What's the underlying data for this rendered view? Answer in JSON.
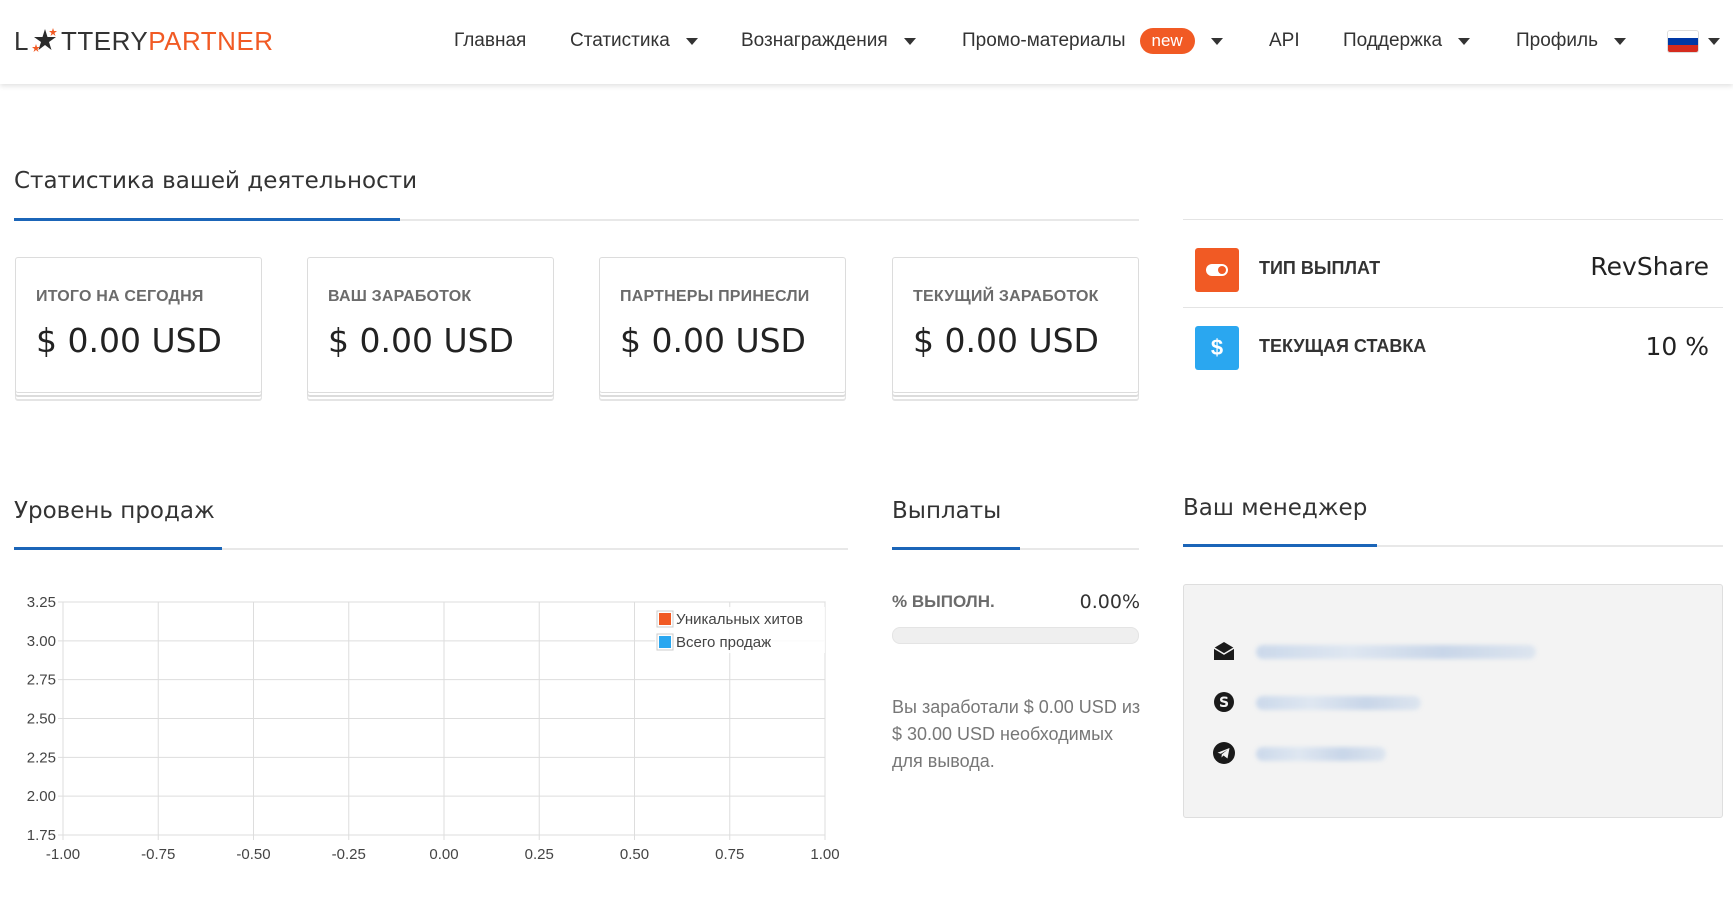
{
  "header": {
    "logo_left": "L",
    "logo_mid": "TTERY",
    "logo_right": "PARTNER",
    "nav": [
      {
        "label": "Главная",
        "has_caret": false
      },
      {
        "label": "Статистика",
        "has_caret": true
      },
      {
        "label": "Вознаграждения",
        "has_caret": true
      },
      {
        "label": "Промо-материалы",
        "badge": "new",
        "has_caret": true
      },
      {
        "label": "API",
        "has_caret": false
      },
      {
        "label": "Поддержка",
        "has_caret": true
      },
      {
        "label": "Профиль",
        "has_caret": true
      }
    ],
    "language_flag": "ru-flag-icon"
  },
  "stats_section": {
    "title": "Статистика вашей деятельности",
    "cards": [
      {
        "label": "ИТОГО НА СЕГОДНЯ",
        "value": "$ 0.00 USD"
      },
      {
        "label": "ВАШ ЗАРАБОТОК",
        "value": "$ 0.00 USD"
      },
      {
        "label": "ПАРТНЕРЫ ПРИНЕСЛИ",
        "value": "$ 0.00 USD"
      },
      {
        "label": "ТЕКУЩИЙ ЗАРАБОТОК",
        "value": "$ 0.00 USD"
      }
    ]
  },
  "payout_info": {
    "type_label": "ТИП ВЫПЛАТ",
    "type_value": "RevShare",
    "type_icon": "toggle-icon",
    "type_icon_color": "#f15a24",
    "rate_label": "ТЕКУЩАЯ СТАВКА",
    "rate_value": "10 %",
    "rate_icon": "dollar-icon",
    "rate_icon_glyph": "$",
    "rate_icon_color": "#2aa7f0"
  },
  "sales_section": {
    "title": "Уровень продаж"
  },
  "chart_data": {
    "type": "line",
    "x_ticks": [
      "-1.00",
      "-0.75",
      "-0.50",
      "-0.25",
      "0.00",
      "0.25",
      "0.50",
      "0.75",
      "1.00"
    ],
    "y_ticks": [
      "3.25",
      "3.00",
      "2.75",
      "2.50",
      "2.25",
      "2.00",
      "1.75"
    ],
    "xlim": [
      -1,
      1
    ],
    "ylim": [
      1.75,
      3.25
    ],
    "grid": true,
    "legend_position": "top-right",
    "series": [
      {
        "name": "Уникальных хитов",
        "color": "#f15a24",
        "values": []
      },
      {
        "name": "Всего продаж",
        "color": "#2aa7f0",
        "values": []
      }
    ]
  },
  "payouts_section": {
    "title": "Выплаты",
    "percent_label": "% ВЫПОЛН.",
    "percent_value": "0.00%",
    "progress": 0,
    "earned_text": "Вы заработали $ 0.00 USD из $ 30.00 USD необходимых для вывода."
  },
  "manager_section": {
    "title": "Ваш менеджер",
    "contacts": [
      {
        "icon": "email-icon"
      },
      {
        "icon": "skype-icon"
      },
      {
        "icon": "telegram-icon"
      }
    ]
  }
}
